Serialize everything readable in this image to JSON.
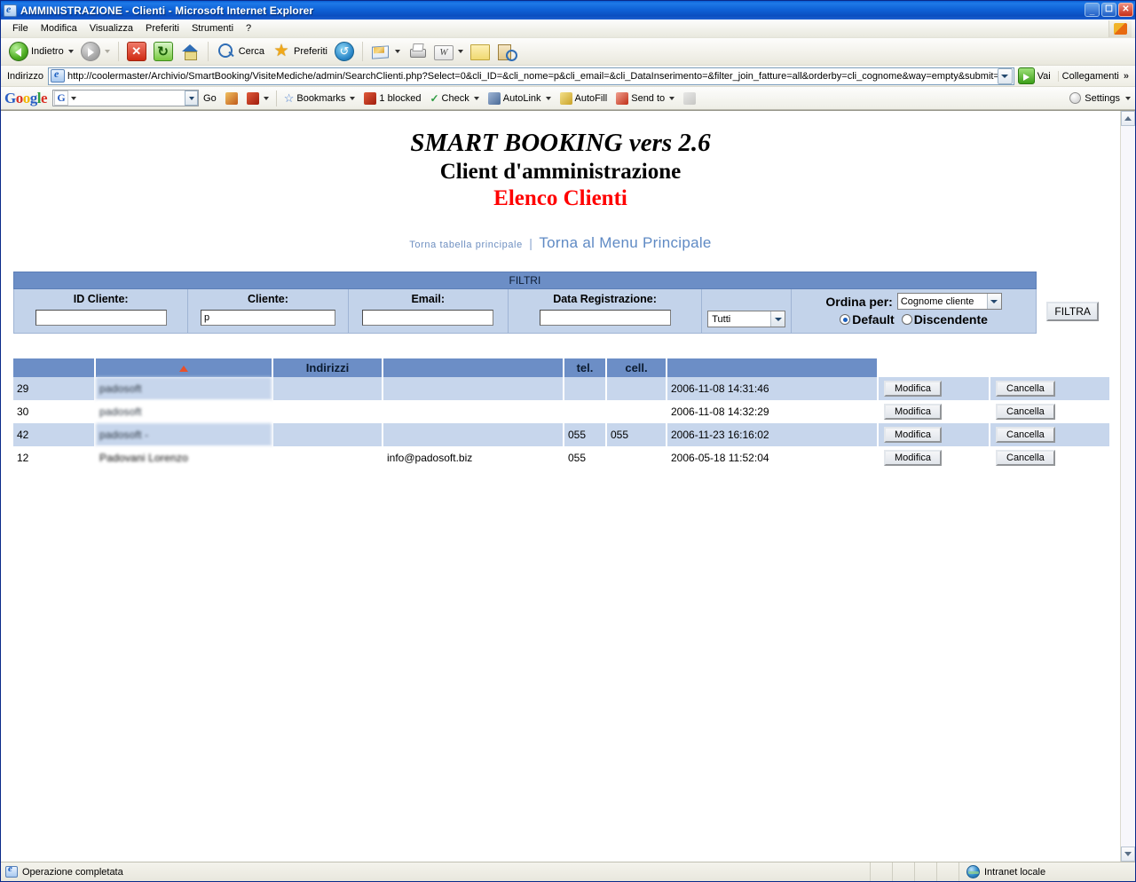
{
  "window": {
    "title": "AMMINISTRAZIONE - Clienti - Microsoft Internet Explorer",
    "minimize_label": "_",
    "maximize_label": "❐",
    "close_label": "✕"
  },
  "menu": {
    "items": [
      "File",
      "Modifica",
      "Visualizza",
      "Preferiti",
      "Strumenti",
      "?"
    ]
  },
  "toolbar": {
    "back_label": "Indietro",
    "search_label": "Cerca",
    "favorites_label": "Preferiti"
  },
  "address": {
    "label": "Indirizzo",
    "url": "http://coolermaster/Archivio/SmartBooking/VisiteMediche/admin/SearchClienti.php?Select=0&cli_ID=&cli_nome=p&cli_email=&cli_DataInserimento=&filter_join_fatture=all&orderby=cli_cognome&way=empty&submit=",
    "go_label": "Vai",
    "links_label": "Collegamenti",
    "chevrons": "»"
  },
  "google_toolbar": {
    "logo": [
      "G",
      "o",
      "o",
      "g",
      "l",
      "e"
    ],
    "search_value": "",
    "go_label": "Go",
    "bookmarks_label": "Bookmarks",
    "blocked_label": "1 blocked",
    "check_label": "Check",
    "autolink_label": "AutoLink",
    "autofill_label": "AutoFill",
    "sendto_label": "Send to",
    "settings_label": "Settings"
  },
  "page": {
    "title_app": "SMART BOOKING vers 2.6",
    "title_sub": "Client d'amministrazione",
    "title_section": "Elenco Clienti",
    "nav_back_table": "Torna tabella principale",
    "nav_separator": "|",
    "nav_main_menu": "Torna al Menu Principale"
  },
  "filters": {
    "header": "FILTRI",
    "fields": [
      {
        "label": "ID Cliente:",
        "value": ""
      },
      {
        "label": "Cliente:",
        "value": "p"
      },
      {
        "label": "Email:",
        "value": ""
      },
      {
        "label": "Data Registrazione:",
        "value": ""
      }
    ],
    "join_select": "Tutti",
    "order_label": "Ordina per:",
    "order_select": "Cognome cliente",
    "radio_default": "Default",
    "radio_descending": "Discendente",
    "radio_selected": "Default",
    "filter_button": "FILTRA"
  },
  "table": {
    "columns": [
      "",
      "",
      "Indirizzi",
      "",
      "tel.",
      "cell.",
      "",
      "",
      ""
    ],
    "sort_indicator_column": 1,
    "rows": [
      {
        "id": "29",
        "cliente": "padosoft",
        "indirizzi": "",
        "email": "",
        "tel": "",
        "cell": "",
        "data": "2006-11-08 14:31:46",
        "edit": "Modifica",
        "delete": "Cancella"
      },
      {
        "id": "30",
        "cliente": "padosoft",
        "indirizzi": "",
        "email": "",
        "tel": "",
        "cell": "",
        "data": "2006-11-08 14:32:29",
        "edit": "Modifica",
        "delete": "Cancella"
      },
      {
        "id": "42",
        "cliente": "padosoft -",
        "indirizzi": "",
        "email": "",
        "tel": "055",
        "cell": "055",
        "data": "2006-11-23 16:16:02",
        "edit": "Modifica",
        "delete": "Cancella"
      },
      {
        "id": "12",
        "cliente": "Padovani Lorenzo",
        "indirizzi": "",
        "email": "info@padosoft.biz",
        "tel": "055",
        "cell": "",
        "data": "2006-05-18 11:52:04",
        "edit": "Modifica",
        "delete": "Cancella"
      }
    ]
  },
  "status": {
    "message": "Operazione completata",
    "zone": "Intranet locale"
  },
  "colors": {
    "header_blue": "#6c8ec6",
    "row_alt": "#c7d6ec",
    "filter_cell": "#c3d3ea",
    "title_red": "#ff0000",
    "link_blue": "#5f8ac4",
    "sort_arrow": "#e8502a"
  }
}
